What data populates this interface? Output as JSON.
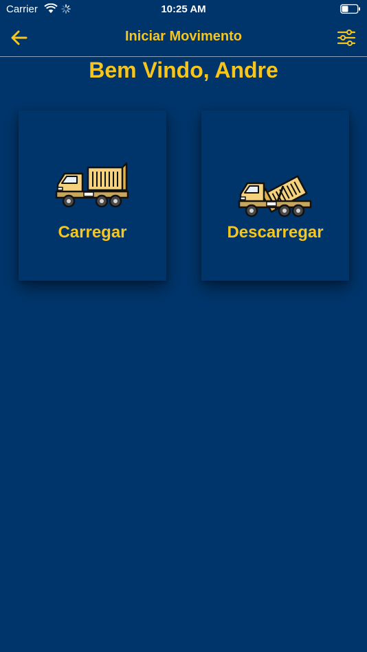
{
  "status_bar": {
    "carrier": "Carrier",
    "time": "10:25 AM"
  },
  "nav": {
    "title": "Iniciar Movimento",
    "back_icon": "arrow-left-icon",
    "filter_icon": "sliders-icon"
  },
  "welcome": "Bem Vindo, Andre",
  "actions": [
    {
      "label": "Carregar",
      "icon": "dump-truck-icon"
    },
    {
      "label": "Descarregar",
      "icon": "dump-truck-unloading-icon"
    }
  ],
  "colors": {
    "background": "#00356b",
    "accent": "#f7c51b"
  }
}
